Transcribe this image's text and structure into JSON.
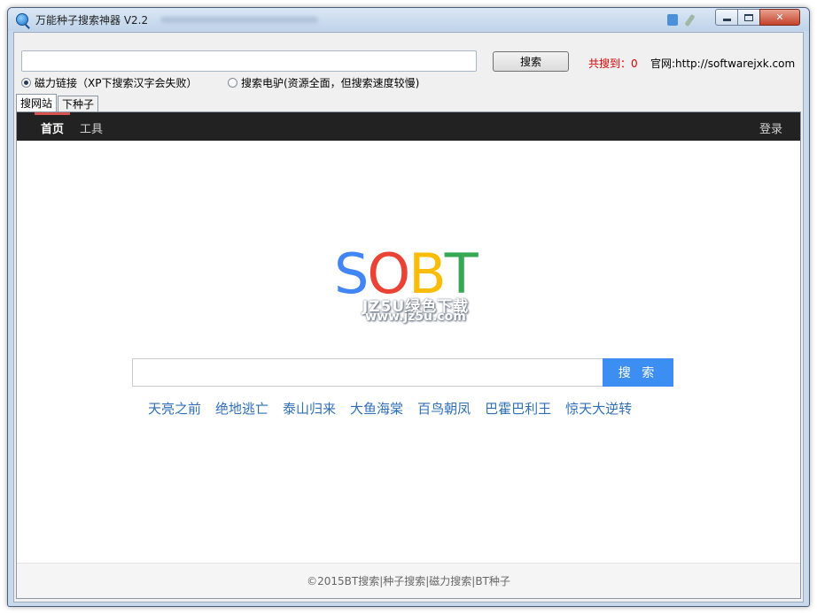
{
  "window": {
    "title": "万能种子搜索神器 V2.2"
  },
  "toolbar": {
    "search_value": "",
    "search_label": "搜索",
    "count_label": "共搜到：0",
    "site_label": "官网:http://softwarejxk.com"
  },
  "options": {
    "radio_magnet": "磁力链接（XP下搜索汉字会失败）",
    "radio_emule": "搜索电驴(资源全面，但搜索速度较慢)",
    "selected": "magnet"
  },
  "tabs": [
    {
      "label": "搜网站",
      "active": true
    },
    {
      "label": "下种子",
      "active": false
    }
  ],
  "web": {
    "nav": {
      "home": "首页",
      "tools": "工具",
      "login": "登录"
    },
    "logo": {
      "letters": [
        "S",
        "O",
        "B",
        "T"
      ],
      "colors": [
        "#4285f4",
        "#ea4335",
        "#fbbc05",
        "#34a853"
      ]
    },
    "watermark": {
      "main": "JZ5U绿色下载",
      "sub": "www.jz5u.com"
    },
    "search": {
      "value": "",
      "button_label": "搜 索"
    },
    "hot_links": [
      "天亮之前",
      "绝地逃亡",
      "泰山归来",
      "大鱼海棠",
      "百鸟朝凤",
      "巴霍巴利王",
      "惊天大逆转"
    ],
    "footer": "©2015BT搜索|种子搜索|磁力搜索|BT种子"
  },
  "colors": {
    "accent_blue": "#3d8ef2",
    "link_blue": "#2f6fb7",
    "count_red": "#e00000",
    "nav_bg": "#222222"
  }
}
